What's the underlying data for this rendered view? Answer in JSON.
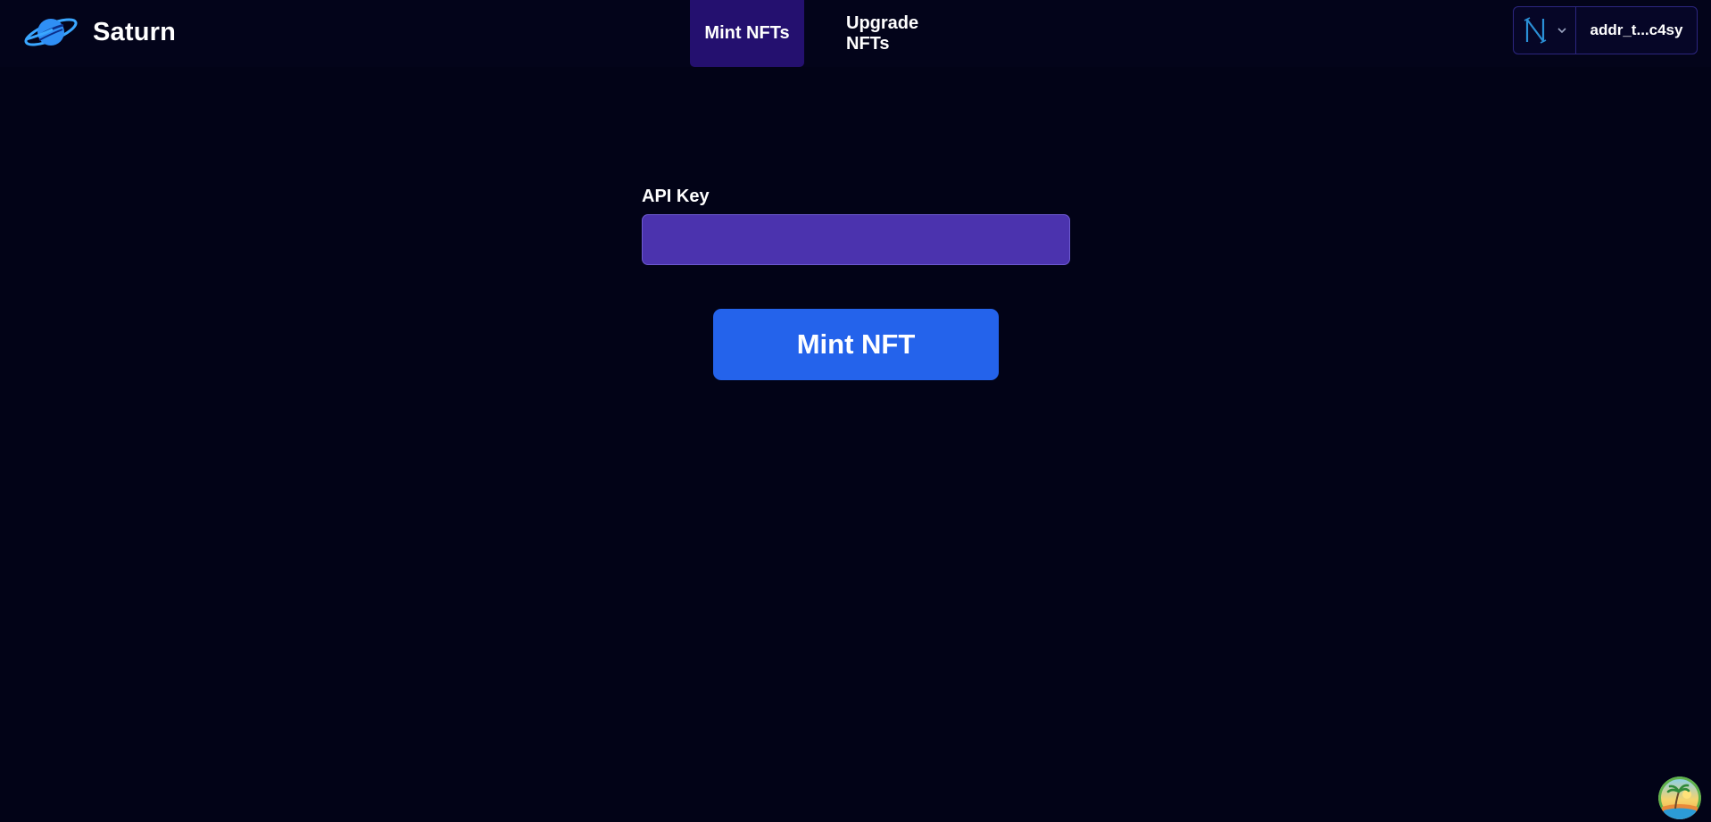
{
  "app": {
    "name": "Saturn",
    "logo_icon": "saturn-planet-icon",
    "accent_color": "#2463eb"
  },
  "nav": {
    "tabs": [
      {
        "label": "Mint NFTs",
        "active": true
      },
      {
        "label": "Upgrade NFTs",
        "active": false
      }
    ]
  },
  "wallet": {
    "network_icon": "network-n-icon",
    "address": "addr_t...c4sy"
  },
  "form": {
    "api_key_label": "API Key",
    "api_key_value": "",
    "api_key_placeholder": ""
  },
  "actions": {
    "mint_label": "Mint NFT"
  },
  "corner": {
    "icon": "palm-beach-avatar-icon"
  }
}
